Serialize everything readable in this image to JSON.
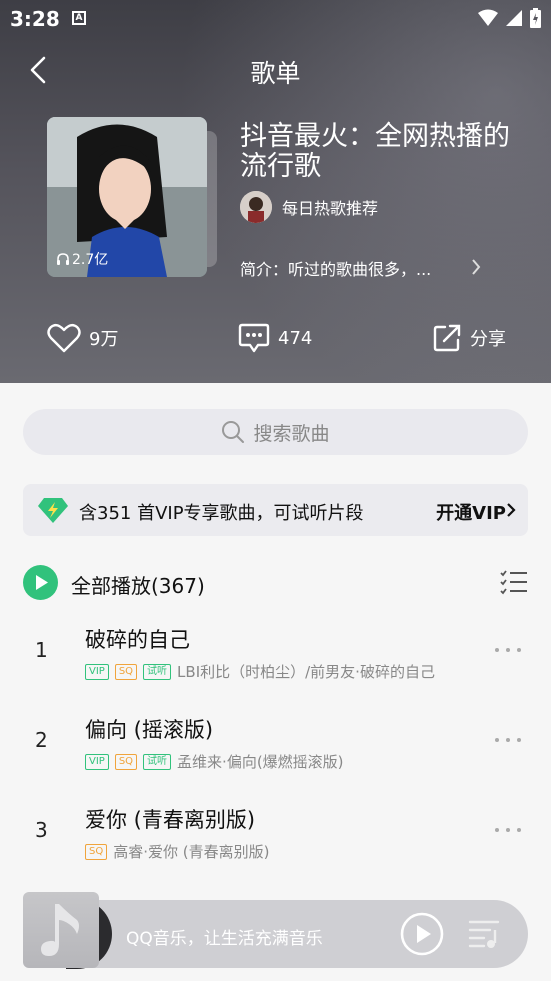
{
  "status": {
    "time": "3:28"
  },
  "header": {
    "title": "歌单"
  },
  "playlist": {
    "title": "抖音最火：全网热播的流行歌",
    "play_count": "2.7亿",
    "creator": "每日热歌推荐",
    "intro": "简介：听过的歌曲很多，..."
  },
  "actions": {
    "likes": "9万",
    "comments": "474",
    "share": "分享"
  },
  "search": {
    "placeholder": "搜索歌曲"
  },
  "vip_banner": {
    "text": "含351 首VIP专享歌曲，可试听片段",
    "button": "开通VIP"
  },
  "play_all": {
    "label": "全部播放(367)"
  },
  "songs": [
    {
      "index": "1",
      "title": "破碎的自己",
      "tags": [
        "VIP",
        "SQ",
        "试听"
      ],
      "artist": "LBI利比（时柏尘）/前男友·破碎的自己"
    },
    {
      "index": "2",
      "title": "偏向 (摇滚版)",
      "tags": [
        "VIP",
        "SQ",
        "试听"
      ],
      "artist": "孟维来·偏向(爆燃摇滚版)"
    },
    {
      "index": "3",
      "title": "爱你 (青春离别版)",
      "tags": [
        "SQ"
      ],
      "artist": "高睿·爱你 (青春离别版)"
    }
  ],
  "mini_player": {
    "text": "QQ音乐，让生活充满音乐"
  },
  "colors": {
    "accent": "#31c27c",
    "sq_tag": "#f0a43c",
    "header_bg": "#4a4a52"
  }
}
